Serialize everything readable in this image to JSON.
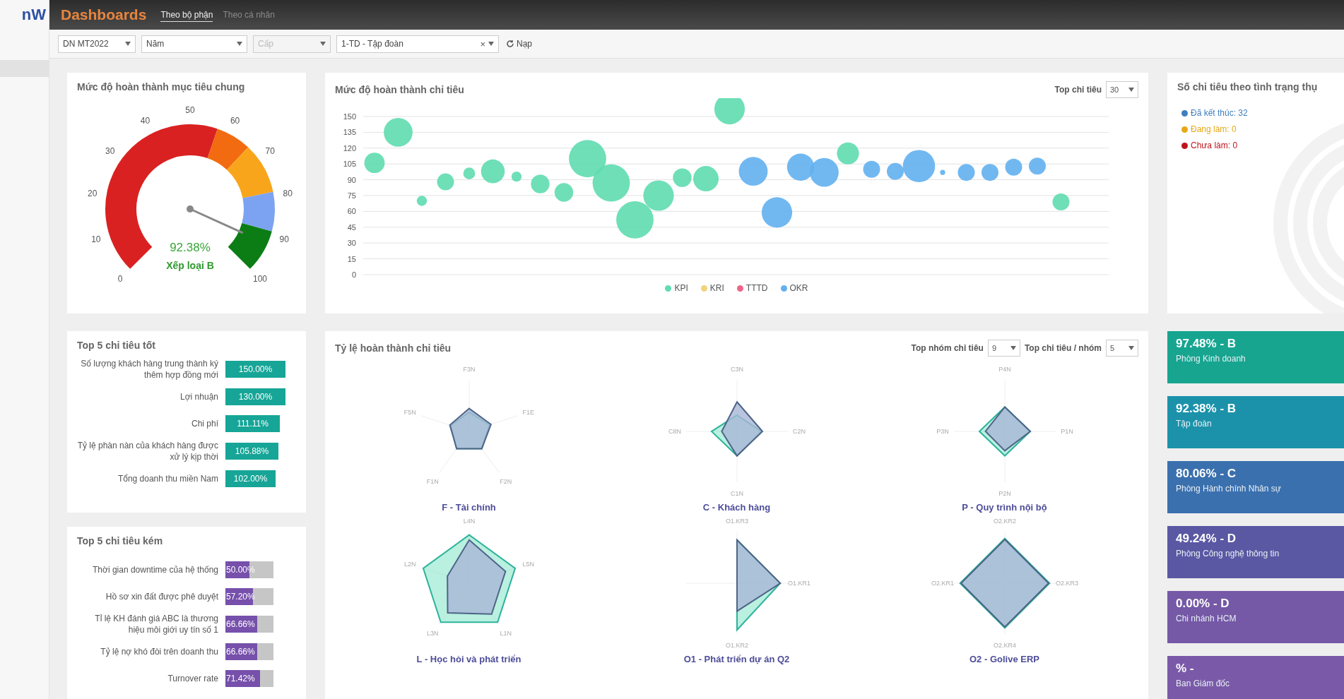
{
  "sidebar": {
    "logo": "nW",
    "selected_item": true
  },
  "topbar": {
    "title": "Dashboards",
    "tabs": [
      {
        "label": "Theo bộ phận",
        "selected": true
      },
      {
        "label": "Theo cá nhân",
        "selected": false
      }
    ]
  },
  "filters": [
    {
      "value": "DN MT2022",
      "disabled": false
    },
    {
      "value": "Năm",
      "disabled": false
    },
    {
      "placeholder": "Cấp",
      "disabled": true
    },
    {
      "value": "1-TD - Tập đoàn",
      "clear": "×",
      "disabled": false
    }
  ],
  "reload_button": {
    "label": "Nạp"
  },
  "gauge_panel": {
    "title": "Mức độ hoàn thành mục tiêu chung",
    "ticks": [
      "0",
      "10",
      "20",
      "30",
      "40",
      "50",
      "60",
      "70",
      "80",
      "90",
      "100"
    ],
    "value": "92.38%",
    "grade": "Xếp loại B"
  },
  "bubble_panel": {
    "title": "Mức độ hoàn thành chỉ tiêu",
    "top_label": "Top chỉ tiêu",
    "top_value": "30",
    "y_labels": [
      "150",
      "135",
      "120",
      "105",
      "90",
      "75",
      "60",
      "45",
      "30",
      "15",
      "0"
    ],
    "legend": [
      {
        "name": "KPI",
        "color": "#5fdcb0"
      },
      {
        "name": "KRI",
        "color": "#f0d37a"
      },
      {
        "name": "TTTD",
        "color": "#f0648a"
      },
      {
        "name": "OKR",
        "color": "#62b0f0"
      }
    ]
  },
  "status_panel": {
    "title": "Số chỉ tiêu theo tình trạng thụ",
    "legend": [
      {
        "label": "Đã kết thúc: 32",
        "color": "#3d7ebf"
      },
      {
        "label": "Đang làm: 0",
        "color": "#e6a817"
      },
      {
        "label": "Chưa làm: 0",
        "color": "#c0141c"
      }
    ]
  },
  "top_good": {
    "title": "Top 5 chỉ tiêu tốt",
    "items": [
      {
        "label": "Số lượng khách hàng trung thành ký thêm hợp đồng mới",
        "value": "150.00%"
      },
      {
        "label": "Lợi nhuận",
        "value": "130.00%"
      },
      {
        "label": "Chi phí",
        "value": "111.11%"
      },
      {
        "label": "Tỷ lệ phàn nàn của khách hàng được xử lý kịp thời",
        "value": "105.88%"
      },
      {
        "label": "Tổng doanh thu miền Nam",
        "value": "102.00%"
      }
    ]
  },
  "top_bad": {
    "title": "Top 5 chỉ tiêu kém",
    "items": [
      {
        "label": "Thời gian downtime của hệ thống",
        "value": "50.00%",
        "level": 0.5
      },
      {
        "label": "Hồ sơ xin đất được phê duyệt",
        "value": "57.20%",
        "level": 0.572
      },
      {
        "label": "Tỉ lệ KH đánh giá ABC là thương hiệu môi giới uy tín số 1",
        "value": "66.66%",
        "level": 0.667
      },
      {
        "label": "Tỷ lệ nợ khó đòi trên doanh thu",
        "value": "66.66%",
        "level": 0.667
      },
      {
        "label": "Turnover rate",
        "value": "71.42%",
        "level": 0.714
      }
    ]
  },
  "radar_panel": {
    "title": "Tỷ lệ hoàn thành chỉ tiêu",
    "controls": [
      {
        "label": "Top nhóm chỉ tiêu",
        "value": "9"
      },
      {
        "label": "Top chỉ tiêu / nhóm",
        "value": "5"
      }
    ],
    "groups": [
      {
        "name": "F - Tài chính",
        "axes": [
          "F3N",
          "F1E",
          "F2N",
          "F1N",
          "F5N"
        ]
      },
      {
        "name": "C - Khách hàng",
        "axes": [
          "C3N",
          "C2N",
          "C1N",
          "C8N"
        ]
      },
      {
        "name": "P - Quy trình nội bộ",
        "axes": [
          "P4N",
          "P1N",
          "P2N",
          "P3N"
        ]
      },
      {
        "name": "L - Học hỏi và phát triển",
        "axes": [
          "L4N",
          "L5N",
          "L1N",
          "L3N",
          "L2N"
        ]
      },
      {
        "name": "O1 - Phát triển dự án Q2",
        "axes": [
          "O1.KR3",
          "O1.KR1",
          "O1.KR2"
        ]
      },
      {
        "name": "O2 - Golive ERP",
        "axes": [
          "O2.KR2",
          "O2.KR3",
          "O2.KR4",
          "O2.KR1"
        ]
      }
    ]
  },
  "unit_cards": [
    {
      "score": "97.48% - B",
      "name": "Phòng Kinh doanh",
      "color": "#17a590"
    },
    {
      "score": "92.38% - B",
      "name": "Tập đoàn",
      "color": "#1b92aa"
    },
    {
      "score": "80.06% - C",
      "name": "Phòng Hành chính Nhân sự",
      "color": "#3b70ae"
    },
    {
      "score": "49.24% - D",
      "name": "Phòng Công nghệ thông tin",
      "color": "#5a58a3"
    },
    {
      "score": "0.00% - D",
      "name": "Chi nhánh HCM",
      "color": "#7559a6"
    },
    {
      "score": "% -",
      "name": "Ban Giám đốc",
      "color": "#7a5aa8"
    }
  ]
}
